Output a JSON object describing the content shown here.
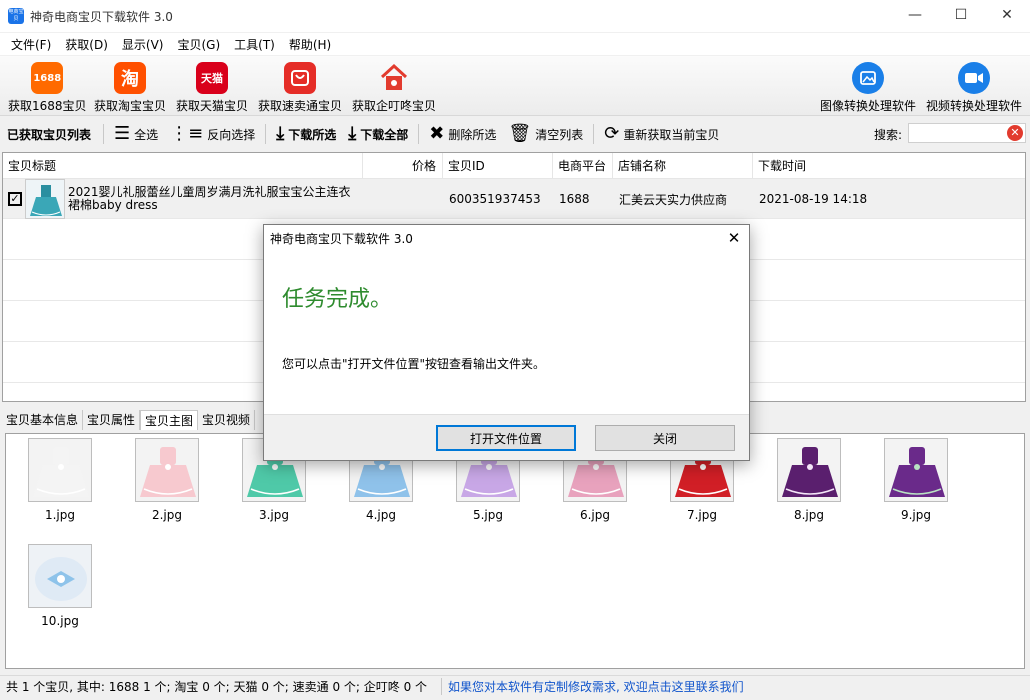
{
  "window": {
    "title": "神奇电商宝贝下载软件 3.0",
    "app_icon_text": "电商宝贝"
  },
  "menu": [
    "文件(F)",
    "获取(D)",
    "显示(V)",
    "宝贝(G)",
    "工具(T)",
    "帮助(H)"
  ],
  "big_toolbar": {
    "items": [
      {
        "label": "获取1688宝贝",
        "icon": "1688-icon",
        "icon_text": "1688",
        "color": "#ff6a00"
      },
      {
        "label": "获取淘宝宝贝",
        "icon": "taobao-icon",
        "icon_text": "淘",
        "color": "#ff5000"
      },
      {
        "label": "获取天猫宝贝",
        "icon": "tmall-icon",
        "icon_text": "天猫",
        "color": "#d9001b"
      },
      {
        "label": "获取速卖通宝贝",
        "icon": "aliexpress-icon",
        "icon_text": "",
        "color": "#e52d27"
      },
      {
        "label": "获取企叮咚宝贝",
        "icon": "qidingdong-icon",
        "icon_text": "",
        "color": "#e23b2e"
      },
      {
        "label": "图像转换处理软件",
        "icon": "image-tool-icon",
        "icon_text": "",
        "color": "#1a7fe8"
      },
      {
        "label": "视频转换处理软件",
        "icon": "video-tool-icon",
        "icon_text": "",
        "color": "#1a7fe8"
      }
    ]
  },
  "toolbar": {
    "title": "已获取宝贝列表",
    "select_all": "全选",
    "invert_select": "反向选择",
    "download_selected": "下载所选",
    "download_all": "下载全部",
    "delete_selected": "删除所选",
    "clear_list": "清空列表",
    "refetch_current": "重新获取当前宝贝",
    "search_label": "搜索:",
    "search_value": ""
  },
  "table": {
    "columns": [
      "宝贝标题",
      "价格",
      "宝贝ID",
      "电商平台",
      "店铺名称",
      "下载时间"
    ],
    "rows": [
      {
        "checked": true,
        "title": "2021婴儿礼服蕾丝儿童周岁满月洗礼服宝宝公主连衣裙棉baby dress",
        "price": "",
        "id": "600351937453",
        "platform": "1688",
        "shop": "汇美云天实力供应商",
        "time": "2021-08-19 14:18"
      }
    ]
  },
  "tabs": [
    "宝贝基本信息",
    "宝贝属性",
    "宝贝主图",
    "宝贝视频"
  ],
  "images": [
    {
      "name": "1.jpg",
      "color": "#f4f4f4",
      "accent": "#ffffff"
    },
    {
      "name": "2.jpg",
      "color": "#f7c9cf",
      "accent": "#ffffff"
    },
    {
      "name": "3.jpg",
      "color": "#4fc9a8",
      "accent": "#ffffff"
    },
    {
      "name": "4.jpg",
      "color": "#8fc2ea",
      "accent": "#ffffff"
    },
    {
      "name": "5.jpg",
      "color": "#c8a7e6",
      "accent": "#ffffff"
    },
    {
      "name": "6.jpg",
      "color": "#e8a2bd",
      "accent": "#ffffff"
    },
    {
      "name": "7.jpg",
      "color": "#d11f26",
      "accent": "#ffffff"
    },
    {
      "name": "8.jpg",
      "color": "#5a1f6e",
      "accent": "#f3e6f8"
    },
    {
      "name": "9.jpg",
      "color": "#6a2a8a",
      "accent": "#b9e3c3"
    },
    {
      "name": "10.jpg",
      "color": "#dfeaf5",
      "accent": "#8ec3ea"
    }
  ],
  "status": {
    "summary": "共 1 个宝贝, 其中: 1688 1 个; 淘宝 0 个; 天猫 0 个; 速卖通 0 个; 企叮咚 0 个",
    "link": "如果您对本软件有定制修改需求, 欢迎点击这里联系我们"
  },
  "dialog": {
    "title": "神奇电商宝贝下载软件 3.0",
    "heading": "任务完成。",
    "message": "您可以点击\"打开文件位置\"按钮查看输出文件夹。",
    "open_button": "打开文件位置",
    "close_button": "关闭"
  }
}
